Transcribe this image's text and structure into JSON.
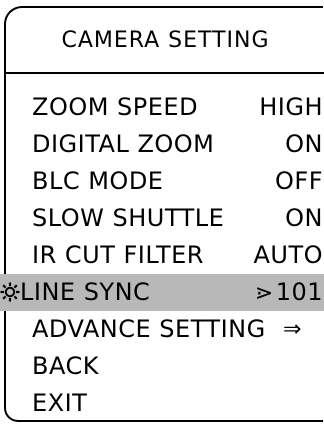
{
  "title": "CAMERA SETTING",
  "menu": {
    "items": [
      {
        "label": "ZOOM SPEED",
        "value": "HIGH"
      },
      {
        "label": "DIGITAL ZOOM",
        "value": "ON"
      },
      {
        "label": "BLC MODE",
        "value": "OFF"
      },
      {
        "label": "SLOW SHUTTLE",
        "value": "ON"
      },
      {
        "label": "IR CUT FILTER",
        "value": "AUTO"
      },
      {
        "label": "LINE SYNC",
        "value": "101",
        "value_prefix_icon": "adjust-arrow-icon",
        "selected": true,
        "cursor_icon": "gear-icon"
      },
      {
        "label": "ADVANCE SETTING",
        "submenu_icon": "right-double-arrow-icon"
      },
      {
        "label": "BACK"
      },
      {
        "label": "EXIT"
      }
    ],
    "highlight_color": "#b8b8b8"
  }
}
